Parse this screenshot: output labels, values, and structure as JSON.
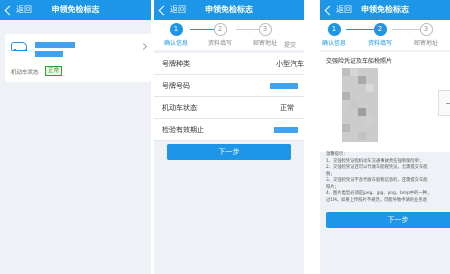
{
  "screens": [
    {
      "nav": {
        "back_label": "返回",
        "title": "申领免检标志"
      },
      "vehicle": {
        "status_label": "机动车状态",
        "status_value": "正常"
      }
    },
    {
      "nav": {
        "back_label": "返回",
        "title": "申领免检标志"
      },
      "steps": [
        {
          "num": "1",
          "label": "确认信息"
        },
        {
          "num": "2",
          "label": "资料填写"
        },
        {
          "num": "3",
          "label": "邮寄地址"
        }
      ],
      "step_partial": "提交",
      "rows": [
        {
          "key": "号牌种类",
          "value": "小型汽车"
        },
        {
          "key": "号牌号码",
          "value": ""
        },
        {
          "key": "机动车状态",
          "value": "正常"
        },
        {
          "key": "检验有效期止",
          "value": ""
        }
      ],
      "next_label": "下一步"
    },
    {
      "nav": {
        "back_label": "返回",
        "title": "申领免检标志"
      },
      "steps": [
        {
          "num": "1",
          "label": "确认信息"
        },
        {
          "num": "2",
          "label": "资料填写"
        },
        {
          "num": "3",
          "label": "邮寄地址"
        }
      ],
      "upload_title": "交强险凭证及车船税照片",
      "notes": [
        "温馨提示：",
        "1、交强险凭证指机动车交通事故责任强制保险单；",
        "2、交强险凭证还可以代收车船税凭证，无需提交车船",
        "税；",
        "3、交强险凭证不含代收车船税信息的，还需提交车船",
        "照片；",
        "4、图片类型必须是jpeg、jpg、png、bmp中的一种，",
        "过1M。如果上传照片不规范，可能导致申请的业务退"
      ],
      "next_label": "下一步"
    }
  ]
}
